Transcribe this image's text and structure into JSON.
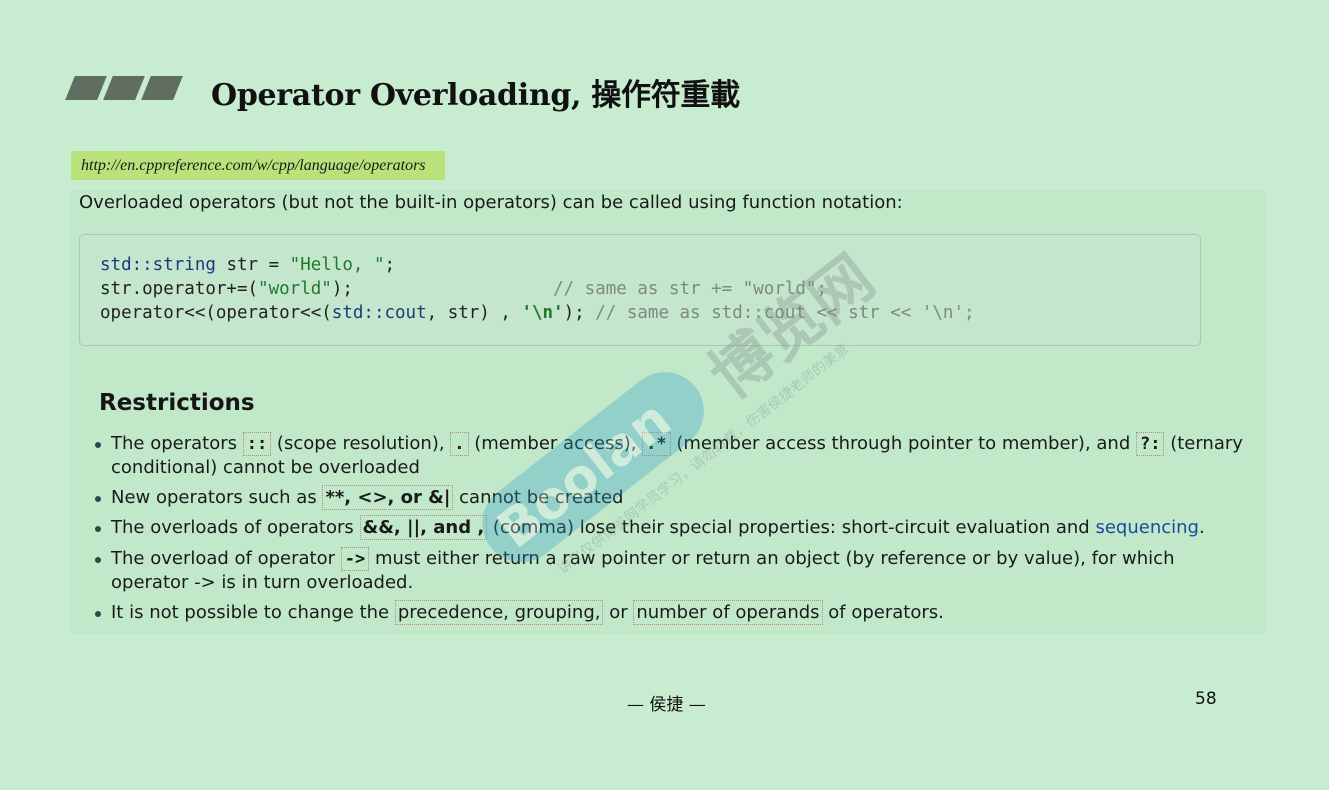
{
  "title": "Operator Overloading, 操作符重載",
  "url": "http://en.cppreference.com/w/cpp/language/operators",
  "intro": "Overloaded operators (but not the built-in operators) can be called using function notation:",
  "code": {
    "line1": [
      "std::string",
      " str = ",
      "\"Hello, \"",
      ";"
    ],
    "line2": [
      "str.operator+=(",
      "\"world\"",
      ");",
      "                   // same as str += \"world\";"
    ],
    "line3": [
      "operator<<(operator<<(",
      "std::cout",
      ", str) , ",
      "'\\n'",
      ");",
      " // same as std::cout << str << '\\n';"
    ]
  },
  "restrictions": {
    "heading": "Restrictions",
    "b1_pre": "The operators ",
    "b1_op1": "::",
    "b1_t1": " (scope resolution), ",
    "b1_op2": ".",
    "b1_t2": " (member access), ",
    "b1_op3": ".*",
    "b1_t3": " (member access through pointer to member), and ",
    "b1_op4": "?:",
    "b1_t4": " (ternary",
    "b1_line2": "conditional) cannot be overloaded",
    "b2_pre": "New operators such as ",
    "b2_ops": "**, <>, or &|",
    "b2_post": " cannot be created",
    "b3_pre": "The overloads of operators ",
    "b3_ops": "&&, ||, and ,",
    "b3_mid": " (comma) lose their special properties: short-circuit evaluation and ",
    "b3_link": "sequencing",
    "b3_end": ".",
    "b4_pre": "The overload of operator ",
    "b4_op": "->",
    "b4_post": " must either return a raw pointer or return an object (by reference or by value), for which",
    "b4_line2": "operator -> is in turn overloaded.",
    "b5_pre": "It is not possible to change the ",
    "b5_box1": "precedence, grouping,",
    "b5_mid": " or ",
    "b5_box2": "number of operands",
    "b5_post": " of operators."
  },
  "footer": "— 侯捷 —",
  "page_number": "58",
  "watermark": {
    "brand": "Boolan",
    "cn": "博览网",
    "note": "讲义仅供博览网学员学习，请勿转载，伤害侯捷老师的美意"
  }
}
